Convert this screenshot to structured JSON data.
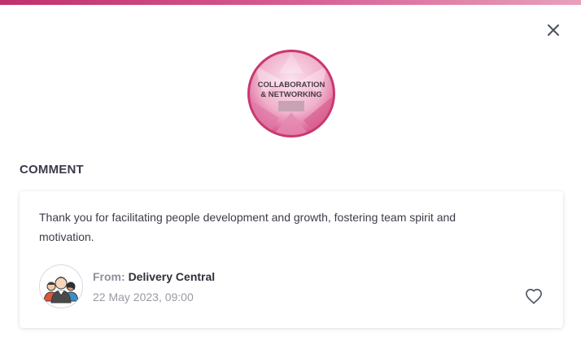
{
  "badge": {
    "line1": "COLLABORATION",
    "line2": "& NETWORKING",
    "icon": "award-badge-icon",
    "accent_color": "#d4578c"
  },
  "section": {
    "title": "COMMENT"
  },
  "comment": {
    "text": "Thank you for facilitating people development and growth, fostering team spirit and motivation.",
    "from_label": "From:",
    "from_name": "Delivery Central",
    "date": "22 May 2023, 09:00",
    "like_icon": "heart-icon",
    "avatar_icon": "group-avatar-icon"
  },
  "actions": {
    "close_icon": "close-icon"
  }
}
